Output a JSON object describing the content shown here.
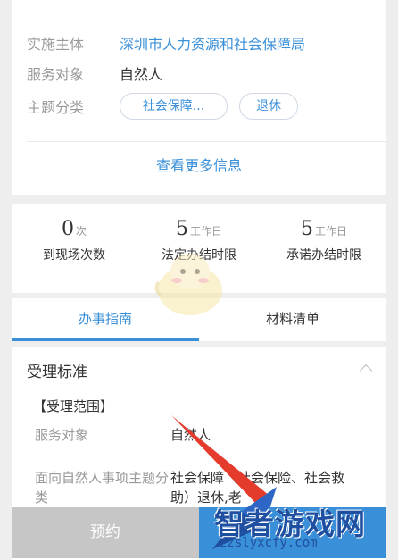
{
  "info": {
    "rows": [
      {
        "label": "实施主体",
        "value": "深圳市人力资源和社会保障局"
      },
      {
        "label": "服务对象",
        "value": "自然人"
      },
      {
        "label": "主题分类",
        "tags": [
          "社会保障...",
          "退休"
        ]
      }
    ],
    "more_link": "查看更多信息"
  },
  "stats": [
    {
      "num": "0",
      "unit": "次",
      "name": "到现场次数"
    },
    {
      "num": "5",
      "unit": "工作日",
      "name": "法定办结时限"
    },
    {
      "num": "5",
      "unit": "工作日",
      "name": "承诺办结时限"
    }
  ],
  "tabs": [
    {
      "label": "办事指南",
      "active": true
    },
    {
      "label": "材料清单",
      "active": false
    }
  ],
  "guide": {
    "section_title": "受理标准",
    "subsection": "【受理范围】",
    "items": [
      {
        "key": "服务对象",
        "value": "自然人"
      },
      {
        "key": "面向自然人事项主题分类",
        "value": "社会保障（社会保险、社会救助）退休,老"
      }
    ]
  },
  "bottom": {
    "appoint_label": "预约"
  },
  "watermark": {
    "brand": "智者游戏网",
    "site": "zzslyxcfy.com"
  },
  "colors": {
    "accent": "#3a8fd9",
    "disabled": "#c6c6c6"
  }
}
